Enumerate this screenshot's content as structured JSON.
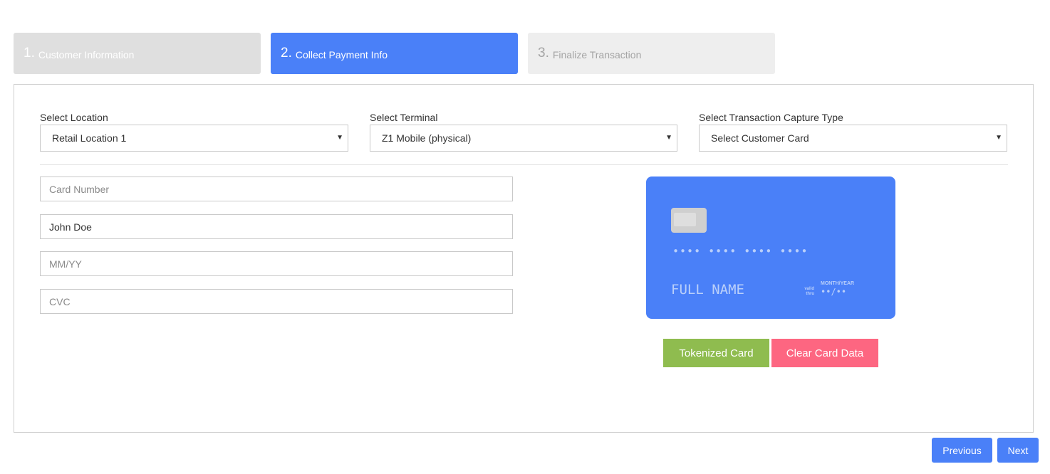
{
  "steps": [
    {
      "number": "1.",
      "label": "Customer Information"
    },
    {
      "number": "2.",
      "label": "Collect Payment Info"
    },
    {
      "number": "3.",
      "label": "Finalize Transaction"
    }
  ],
  "selects": {
    "location": {
      "label": "Select Location",
      "value": "Retail Location 1"
    },
    "terminal": {
      "label": "Select Terminal",
      "value": "Z1 Mobile (physical)"
    },
    "capture_type": {
      "label": "Select Transaction Capture Type",
      "value": "Select Customer Card"
    }
  },
  "card_form": {
    "number": {
      "placeholder": "Card Number",
      "value": ""
    },
    "name": {
      "placeholder": "Full Name",
      "value": "John Doe"
    },
    "expiry": {
      "placeholder": "MM/YY",
      "value": ""
    },
    "cvc": {
      "placeholder": "CVC",
      "value": ""
    }
  },
  "card_preview": {
    "number": "•••• •••• •••• ••••",
    "name": "FULL NAME",
    "valid_thru_line1": "valid",
    "valid_thru_line2": "thru",
    "month_year": "MONTH/YEAR",
    "expiry": "••/••"
  },
  "actions": {
    "tokenize": "Tokenized Card",
    "clear": "Clear Card Data"
  },
  "nav": {
    "previous": "Previous",
    "next": "Next"
  },
  "colors": {
    "primary": "#4a80f8",
    "success": "#8fbc4f",
    "danger": "#fd6681"
  }
}
